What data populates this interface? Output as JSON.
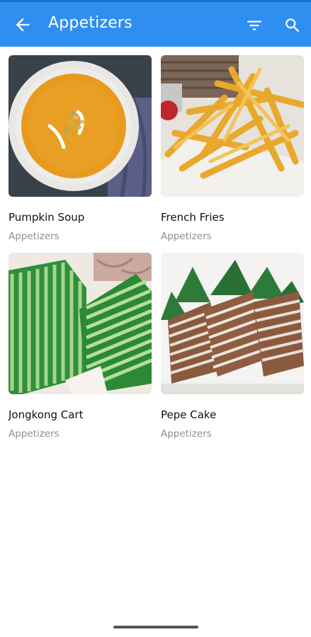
{
  "header": {
    "title": "Appetizers",
    "background_color": "#2f8ff0",
    "back_icon": "arrow-left-icon",
    "filter_icon": "filter-icon",
    "search_icon": "search-icon"
  },
  "items": [
    {
      "name": "Pumpkin Soup",
      "category": "Appetizers",
      "image": "pumpkin-soup-photo"
    },
    {
      "name": "French Fries",
      "category": "Appetizers",
      "image": "french-fries-photo"
    },
    {
      "name": "Jongkong Cart",
      "category": "Appetizers",
      "image": "jongkong-cart-photo"
    },
    {
      "name": "Pepe Cake",
      "category": "Appetizers",
      "image": "pepe-cake-photo"
    }
  ]
}
